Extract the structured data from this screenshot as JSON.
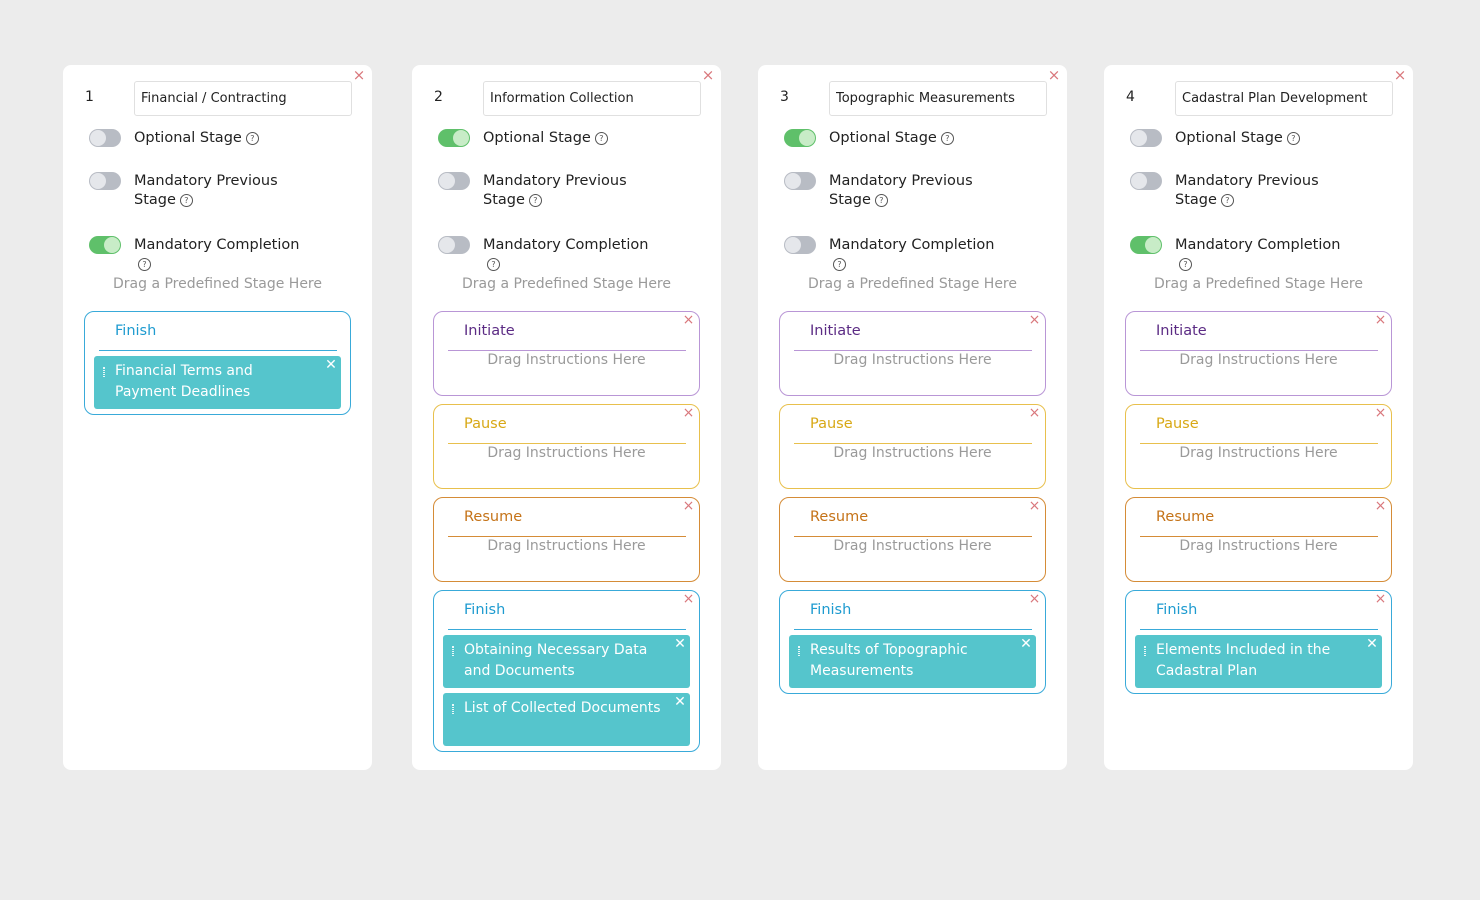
{
  "common": {
    "optional_label": "Optional Stage",
    "mandatory_prev_label": "Mandatory Previous Stage",
    "mandatory_completion_label": "Mandatory Completion",
    "drag_stage_text": "Drag a Predefined Stage Here",
    "drag_instructions_text": "Drag Instructions Here",
    "help_glyph": "?",
    "close_glyph": "×",
    "instruction_close_glyph": "✕",
    "help_icon": "question-circle-icon",
    "close_icon": "close-icon"
  },
  "colors": {
    "initiate": "#b996d6",
    "pause": "#e8c04d",
    "resume": "#d58c37",
    "finish": "#39aad9",
    "instruction": "#55c5cc",
    "toggle_on": "#5fc06a",
    "toggle_off": "#b8bcc4"
  },
  "stages": [
    {
      "number": "1",
      "name": "Financial / Contracting",
      "optional": false,
      "mandatory_previous": false,
      "mandatory_completion": true,
      "blocks": [
        {
          "type": "finish",
          "title": "Finish",
          "instructions": [
            "Financial Terms and Payment Deadlines"
          ]
        }
      ]
    },
    {
      "number": "2",
      "name": "Information Collection",
      "optional": true,
      "mandatory_previous": false,
      "mandatory_completion": false,
      "blocks": [
        {
          "type": "initiate",
          "title": "Initiate",
          "instructions": []
        },
        {
          "type": "pause",
          "title": "Pause",
          "instructions": []
        },
        {
          "type": "resume",
          "title": "Resume",
          "instructions": []
        },
        {
          "type": "finish",
          "title": "Finish",
          "instructions": [
            "Obtaining Necessary Data and Documents",
            "List of Collected Documents"
          ]
        }
      ]
    },
    {
      "number": "3",
      "name": "Topographic Measurements",
      "optional": true,
      "mandatory_previous": false,
      "mandatory_completion": false,
      "blocks": [
        {
          "type": "initiate",
          "title": "Initiate",
          "instructions": []
        },
        {
          "type": "pause",
          "title": "Pause",
          "instructions": []
        },
        {
          "type": "resume",
          "title": "Resume",
          "instructions": []
        },
        {
          "type": "finish",
          "title": "Finish",
          "instructions": [
            "Results of Topographic Measurements"
          ]
        }
      ]
    },
    {
      "number": "4",
      "name": "Cadastral Plan Development",
      "optional": false,
      "mandatory_previous": false,
      "mandatory_completion": true,
      "blocks": [
        {
          "type": "initiate",
          "title": "Initiate",
          "instructions": []
        },
        {
          "type": "pause",
          "title": "Pause",
          "instructions": []
        },
        {
          "type": "resume",
          "title": "Resume",
          "instructions": []
        },
        {
          "type": "finish",
          "title": "Finish",
          "instructions": [
            "Elements Included in the Cadastral Plan"
          ]
        }
      ]
    }
  ]
}
